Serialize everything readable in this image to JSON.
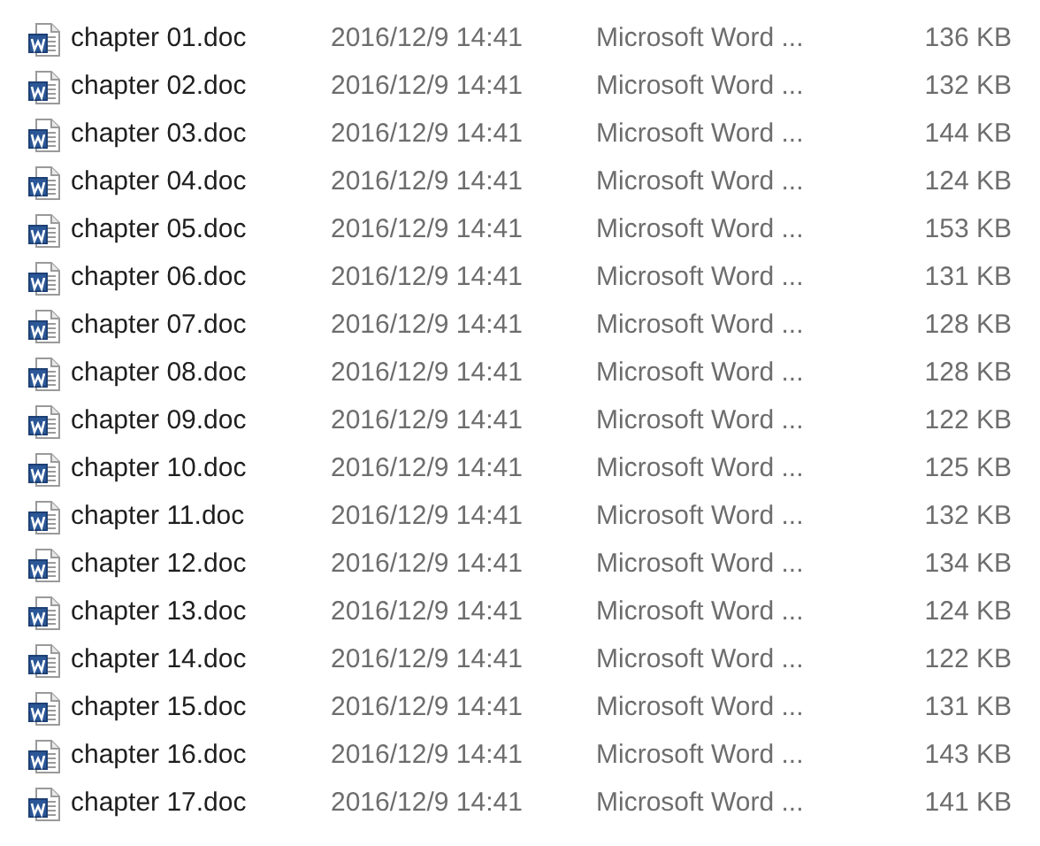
{
  "files": [
    {
      "name": "chapter 01.doc",
      "date": "2016/12/9 14:41",
      "type": "Microsoft Word ...",
      "size": "136 KB"
    },
    {
      "name": "chapter 02.doc",
      "date": "2016/12/9 14:41",
      "type": "Microsoft Word ...",
      "size": "132 KB"
    },
    {
      "name": "chapter 03.doc",
      "date": "2016/12/9 14:41",
      "type": "Microsoft Word ...",
      "size": "144 KB"
    },
    {
      "name": "chapter 04.doc",
      "date": "2016/12/9 14:41",
      "type": "Microsoft Word ...",
      "size": "124 KB"
    },
    {
      "name": "chapter 05.doc",
      "date": "2016/12/9 14:41",
      "type": "Microsoft Word ...",
      "size": "153 KB"
    },
    {
      "name": "chapter 06.doc",
      "date": "2016/12/9 14:41",
      "type": "Microsoft Word ...",
      "size": "131 KB"
    },
    {
      "name": "chapter 07.doc",
      "date": "2016/12/9 14:41",
      "type": "Microsoft Word ...",
      "size": "128 KB"
    },
    {
      "name": "chapter 08.doc",
      "date": "2016/12/9 14:41",
      "type": "Microsoft Word ...",
      "size": "128 KB"
    },
    {
      "name": "chapter 09.doc",
      "date": "2016/12/9 14:41",
      "type": "Microsoft Word ...",
      "size": "122 KB"
    },
    {
      "name": "chapter 10.doc",
      "date": "2016/12/9 14:41",
      "type": "Microsoft Word ...",
      "size": "125 KB"
    },
    {
      "name": "chapter 11.doc",
      "date": "2016/12/9 14:41",
      "type": "Microsoft Word ...",
      "size": "132 KB"
    },
    {
      "name": "chapter 12.doc",
      "date": "2016/12/9 14:41",
      "type": "Microsoft Word ...",
      "size": "134 KB"
    },
    {
      "name": "chapter 13.doc",
      "date": "2016/12/9 14:41",
      "type": "Microsoft Word ...",
      "size": "124 KB"
    },
    {
      "name": "chapter 14.doc",
      "date": "2016/12/9 14:41",
      "type": "Microsoft Word ...",
      "size": "122 KB"
    },
    {
      "name": "chapter 15.doc",
      "date": "2016/12/9 14:41",
      "type": "Microsoft Word ...",
      "size": "131 KB"
    },
    {
      "name": "chapter 16.doc",
      "date": "2016/12/9 14:41",
      "type": "Microsoft Word ...",
      "size": "143 KB"
    },
    {
      "name": "chapter 17.doc",
      "date": "2016/12/9 14:41",
      "type": "Microsoft Word ...",
      "size": "141 KB"
    }
  ]
}
